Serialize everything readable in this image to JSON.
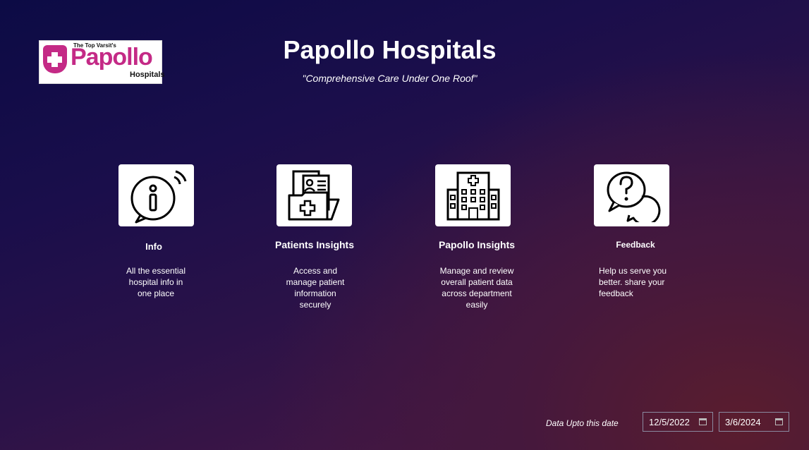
{
  "logo": {
    "tagline": "The Top Varsit's",
    "name": "Papollo",
    "sub": "Hospitals"
  },
  "header": {
    "title": "Papollo Hospitals",
    "tagline": "\"Comprehensive Care Under One Roof\""
  },
  "cards": [
    {
      "title": "Info",
      "desc": [
        "All the essential",
        "hospital info in",
        "one place"
      ],
      "icon": "info-icon"
    },
    {
      "title": "Patients Insights",
      "desc": [
        "Access and",
        "manage patient",
        "information",
        "securely"
      ],
      "icon": "patient-folder-icon"
    },
    {
      "title": "Papollo Insights",
      "desc": [
        "Manage and review",
        "overall patient data",
        "across department",
        "easily"
      ],
      "icon": "hospital-building-icon"
    },
    {
      "title": "Feedback",
      "desc": [
        "Help us serve you",
        "better. share your",
        "feedback"
      ],
      "icon": "chat-question-icon"
    }
  ],
  "date_filter": {
    "label": "Data Upto this date",
    "start": "12/5/2022",
    "end": "3/6/2024"
  }
}
